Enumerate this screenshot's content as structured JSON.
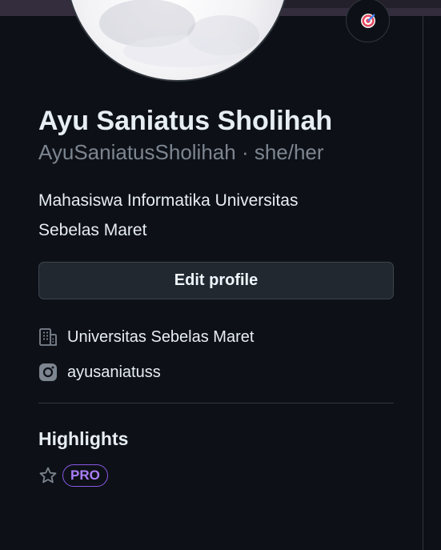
{
  "profile": {
    "full_name": "Ayu Saniatus Sholihah",
    "username": "AyuSaniatusSholihah",
    "separator": " · ",
    "pronouns": "she/her",
    "bio_line1": "Mahasiswa Informatika Universitas",
    "bio_line2": "Sebelas Maret",
    "status_icon": "target-emoji-icon"
  },
  "actions": {
    "edit_profile_label": "Edit profile"
  },
  "details": {
    "organization": "Universitas Sebelas Maret",
    "organization_icon": "organization-icon",
    "instagram": "ayusaniatuss",
    "instagram_icon": "instagram-icon"
  },
  "highlights": {
    "title": "Highlights",
    "star_icon": "star-icon",
    "badge": "PRO"
  },
  "colors": {
    "background": "#0d1117",
    "text_primary": "#e6edf3",
    "text_muted": "#7d8590",
    "border": "#30363d",
    "pro_badge": "#ab7df8"
  }
}
